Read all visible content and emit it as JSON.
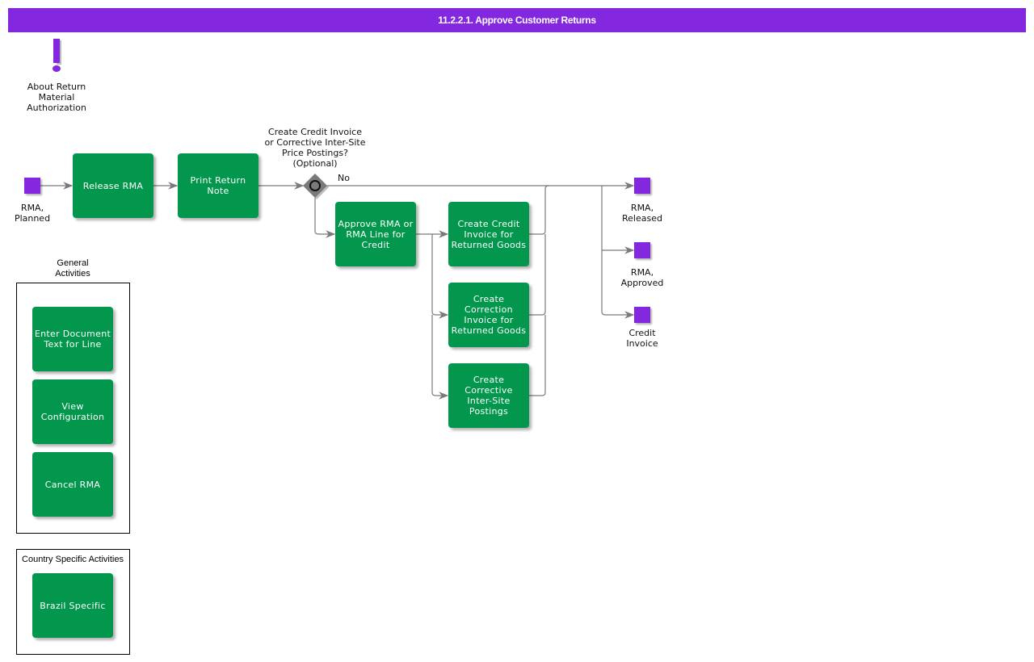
{
  "header": {
    "title": "11.2.2.1. Approve Customer Returns"
  },
  "colors": {
    "accent": "#8428e0",
    "activity": "#02974c",
    "gateway": "#7a7a7a",
    "connector": "#7a7a7a"
  },
  "info": {
    "icon": "exclamation-icon",
    "label": "About Return\nMaterial\nAuthorization"
  },
  "events": {
    "start": "RMA,\nPlanned",
    "released": "RMA,\nReleased",
    "approved": "RMA,\nApproved",
    "credit_invoice": "Credit\nInvoice"
  },
  "activities": {
    "release_rma": "Release RMA",
    "print_return_note": "Print Return\nNote",
    "approve_rma": "Approve RMA or\nRMA Line for\nCredit",
    "create_credit_invoice": "Create Credit\nInvoice for\nReturned Goods",
    "create_correction_invoice": "Create\nCorrection\nInvoice for\nReturned Goods",
    "create_corrective_postings": "Create\nCorrective\nInter-Site\nPostings"
  },
  "gateway": {
    "question": "Create Credit Invoice\nor Corrective Inter-Site\nPrice Postings?\n(Optional)",
    "no_label": "No"
  },
  "general_activities": {
    "title": "General\nActivities",
    "items": [
      "Enter Document\nText for Line",
      "View\nConfiguration",
      "Cancel RMA"
    ]
  },
  "country_activities": {
    "title": "Country Specific Activities",
    "items": [
      "Brazil Specific"
    ]
  }
}
